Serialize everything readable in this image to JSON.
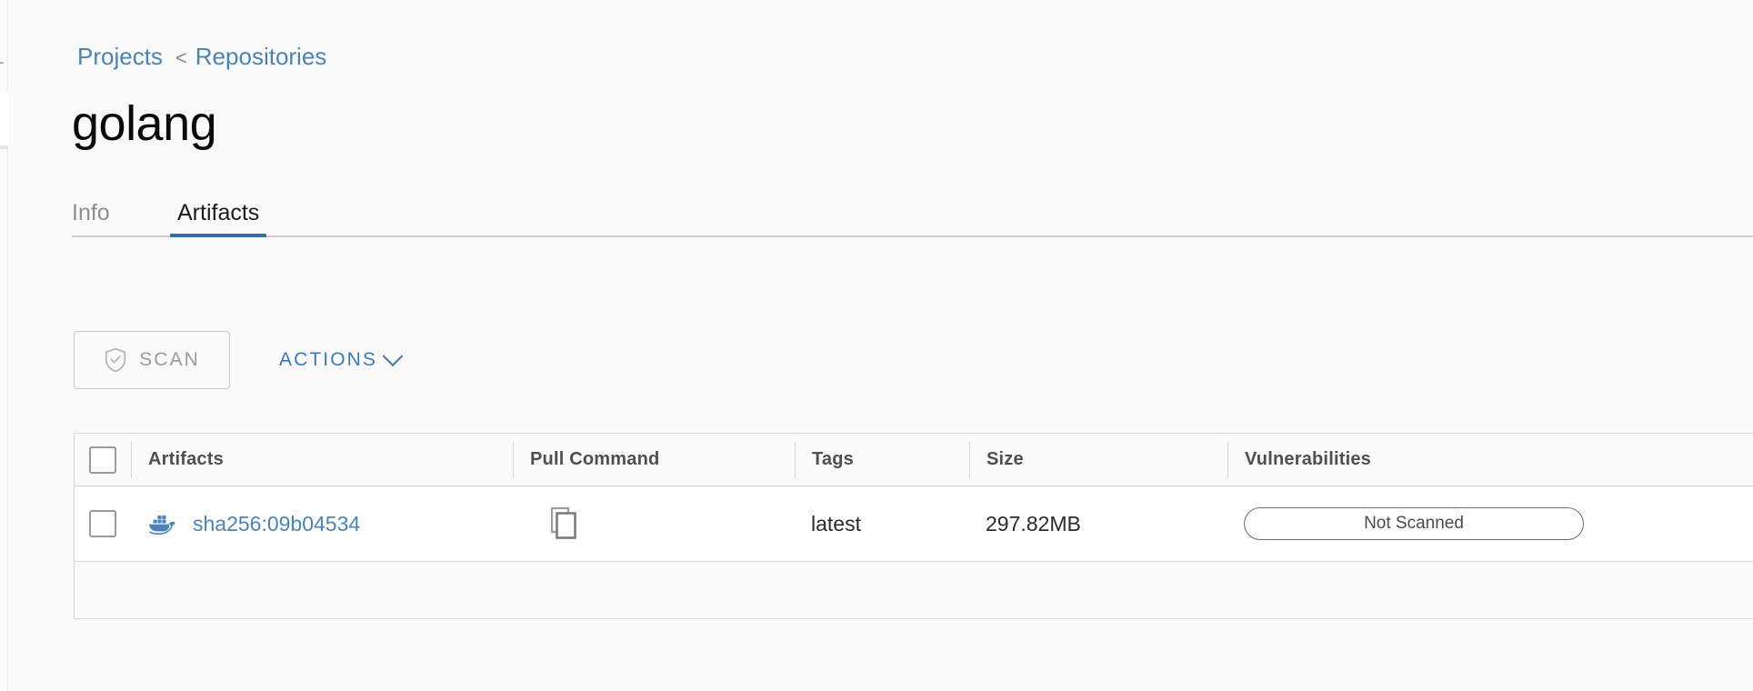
{
  "breadcrumb": {
    "items": [
      {
        "label": "Projects"
      },
      {
        "label": "Repositories"
      }
    ],
    "separator": "<"
  },
  "page": {
    "title": "golang"
  },
  "tabs": [
    {
      "label": "Info",
      "active": false
    },
    {
      "label": "Artifacts",
      "active": true
    }
  ],
  "toolbar": {
    "scan_label": "SCAN",
    "scan_icon": "shield-check-icon",
    "scan_disabled": true,
    "actions_label": "ACTIONS",
    "actions_icon": "chevron-down-icon"
  },
  "table": {
    "columns": [
      {
        "key": "select",
        "label": ""
      },
      {
        "key": "artifacts",
        "label": "Artifacts"
      },
      {
        "key": "pull_command",
        "label": "Pull Command"
      },
      {
        "key": "tags",
        "label": "Tags"
      },
      {
        "key": "size",
        "label": "Size"
      },
      {
        "key": "vulnerabilities",
        "label": "Vulnerabilities"
      }
    ],
    "rows": [
      {
        "selected": false,
        "artifact_icon": "docker-whale-icon",
        "artifact_digest": "sha256:09b04534",
        "pull_command_icon": "copy-icon",
        "tags": "latest",
        "size": "297.82MB",
        "vulnerabilities": "Not Scanned"
      }
    ]
  },
  "colors": {
    "link_blue": "#4a84b7",
    "accent_blue": "#30719e",
    "action_blue": "#3d7ab5",
    "page_bg": "#fafafa",
    "row_bg": "#ffffff",
    "border": "#d6d6d6",
    "muted_text": "#8e8e8e"
  }
}
